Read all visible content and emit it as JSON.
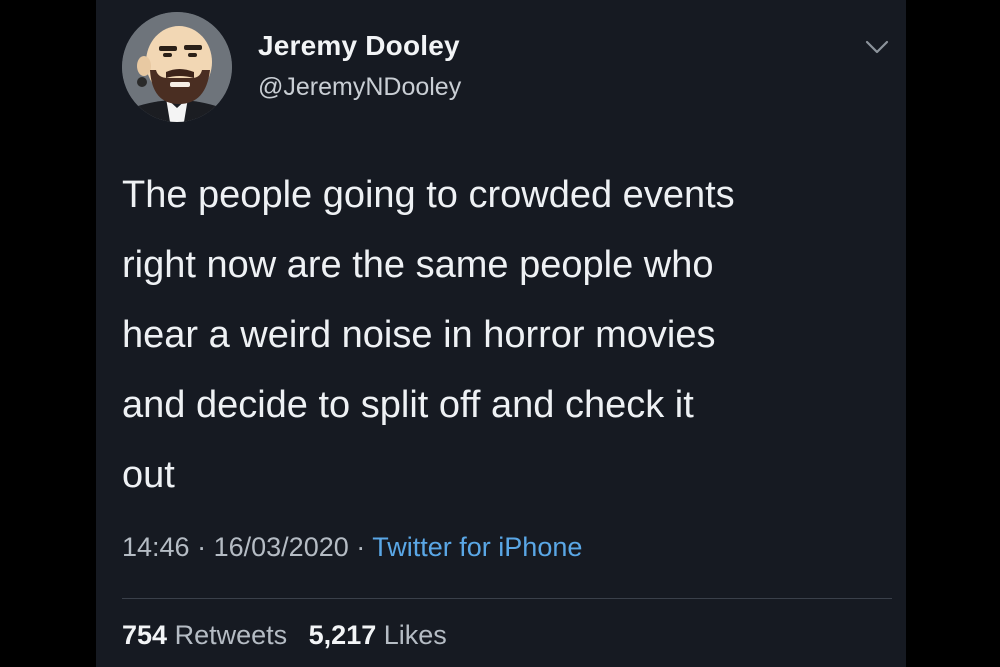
{
  "user": {
    "display_name": "Jeremy Dooley",
    "handle": "@JeremyNDooley",
    "avatar_icon": "cartoon-bald-bearded-man-avatar"
  },
  "menu": {
    "icon": "chevron-down-icon"
  },
  "tweet": {
    "lines": [
      "The people going to crowded events",
      "right now are the same people who",
      "hear a weird noise in horror movies",
      "and decide to split off and check it",
      "out"
    ]
  },
  "meta": {
    "time": "14:46",
    "separator": "·",
    "date": "16/03/2020",
    "source": "Twitter for iPhone"
  },
  "stats": {
    "retweets_count": "754",
    "retweets_label": "Retweets",
    "likes_count": "5,217",
    "likes_label": "Likes"
  },
  "colors": {
    "background": "#000000",
    "card": "#161a22",
    "text": "#eef1f4",
    "muted": "#b5bcc4",
    "link": "#5aa7e6"
  }
}
